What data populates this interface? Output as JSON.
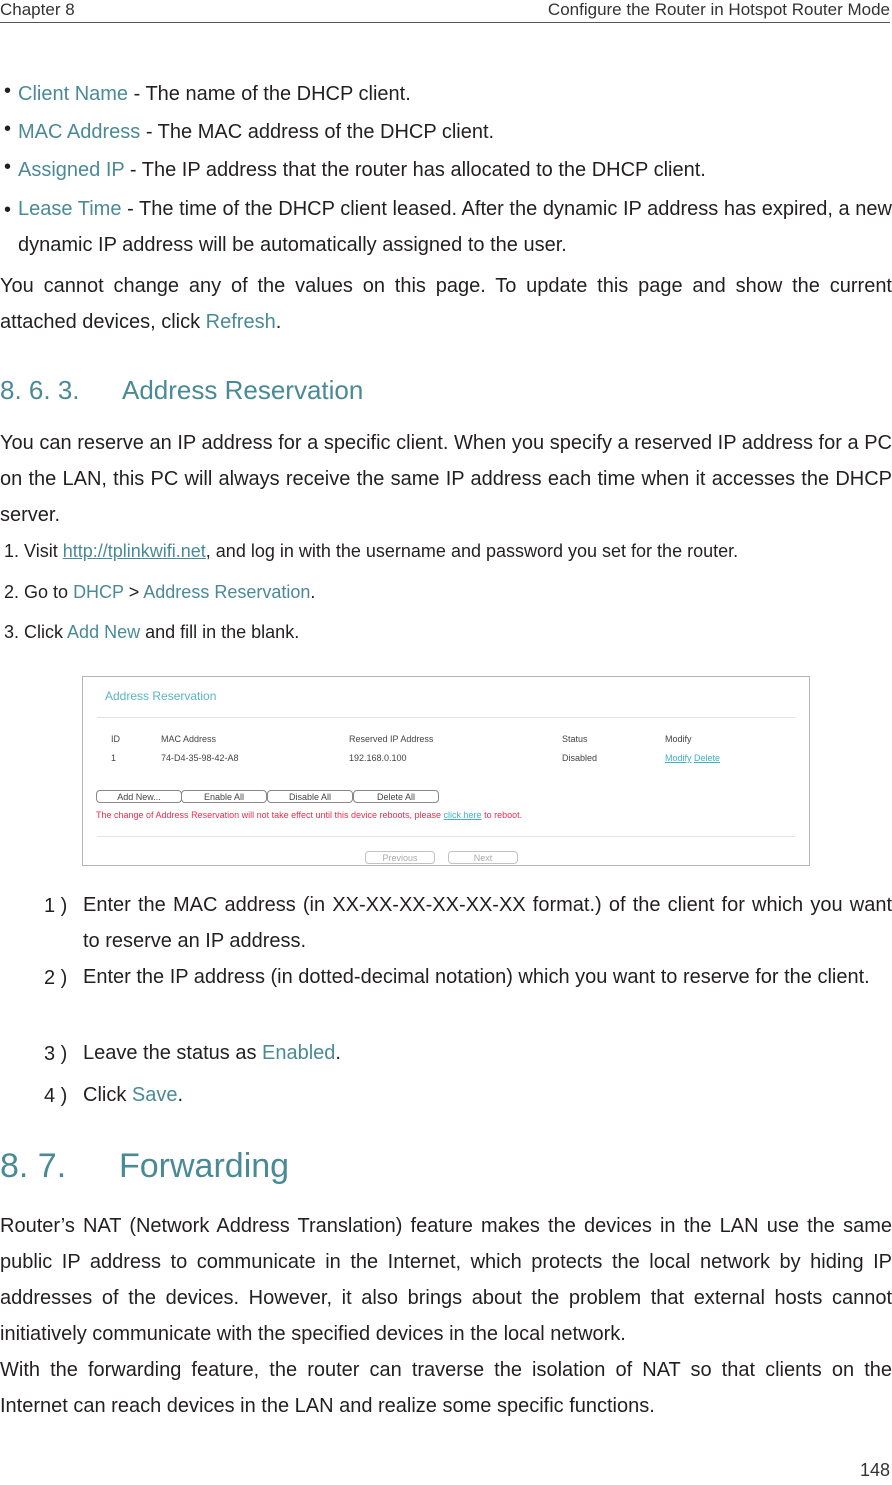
{
  "header": {
    "chapter": "Chapter 8",
    "section_title": "Configure the Router in Hotspot Router Mode"
  },
  "bullets": [
    {
      "term": "Client Name",
      "desc": " - The name of the DHCP client."
    },
    {
      "term": "MAC Address",
      "desc": " - The MAC address of the DHCP client."
    },
    {
      "term": "Assigned IP",
      "desc": " - The IP address that the router has allocated to the DHCP client."
    },
    {
      "term": "Lease Time",
      "desc": " - The time of the DHCP client leased. After the dynamic IP address has expired, a new dynamic IP address will be automatically assigned to the user."
    }
  ],
  "note": {
    "text_before": "You cannot change any of the values on this page. To update this page and show the current attached devices, click ",
    "link": "Refresh",
    "text_after": "."
  },
  "section_863": {
    "number": "8. 6. 3.",
    "title": "Address Reservation",
    "intro": "You can reserve an IP address for a specific client. When you specify a reserved IP address for a PC on the LAN, this PC will always receive the same IP address each time when it accesses the DHCP server.",
    "steps": [
      {
        "num": "1.",
        "before": "Visit ",
        "link": "http://tplinkwifi.net",
        "after": ", and log in with the username and password you set for the router."
      },
      {
        "num": "2.",
        "before": "Go to ",
        "link": "DHCP",
        "mid": " > ",
        "link2": "Address Reservation",
        "after": "."
      },
      {
        "num": "3.",
        "before": "Click ",
        "link": "Add New",
        "after": " and fill in the blank."
      }
    ],
    "substeps": [
      {
        "num": "1 )",
        "before": "Enter the MAC address (in XX-XX-XX-XX-XX-XX format.) of the client for which you want to reserve an IP address.",
        "link": "",
        "after": ""
      },
      {
        "num": "2 )",
        "before": "Enter the IP address (in dotted-decimal notation) which you want to reserve for the client.",
        "link": "",
        "after": ""
      },
      {
        "num": "3 )",
        "before": "Leave the status as ",
        "link": "Enabled",
        "after": "."
      },
      {
        "num": "4 )",
        "before": "Click ",
        "link": "Save",
        "after": "."
      }
    ]
  },
  "screenshot": {
    "title": "Address Reservation",
    "columns": [
      "ID",
      "MAC Address",
      "Reserved IP Address",
      "Status",
      "Modify"
    ],
    "rows": [
      {
        "id": "1",
        "mac": "74-D4-35-98-42-A8",
        "ip": "192.168.0.100",
        "status": "Disabled",
        "modify": "Modify",
        "delete": "Delete"
      }
    ],
    "buttons": {
      "add_new": "Add New...",
      "enable_all": "Enable All",
      "disable_all": "Disable All",
      "delete_all": "Delete All",
      "previous": "Previous",
      "next": "Next"
    },
    "warning_before": "The change of Address Reservation will not take effect until this device reboots, please ",
    "warning_link": "click here",
    "warning_after": " to reboot."
  },
  "section_87": {
    "number": "8. 7.",
    "title": "Forwarding",
    "para1": "Router’s NAT (Network Address Translation) feature makes the devices in the LAN use the same public IP address to communicate in the Internet, which protects the local network by hiding IP addresses of the devices. However, it also brings about the problem that external hosts cannot initiatively communicate with the specified devices in the local network.",
    "para2": "With the forwarding feature, the router can traverse the isolation of NAT so that clients on the Internet can reach devices in the LAN and realize some specific functions."
  },
  "page_number": "148",
  "colors": {
    "accent": "#4a8a96",
    "ui_title": "#59b5c3",
    "warning": "#e8304f"
  }
}
